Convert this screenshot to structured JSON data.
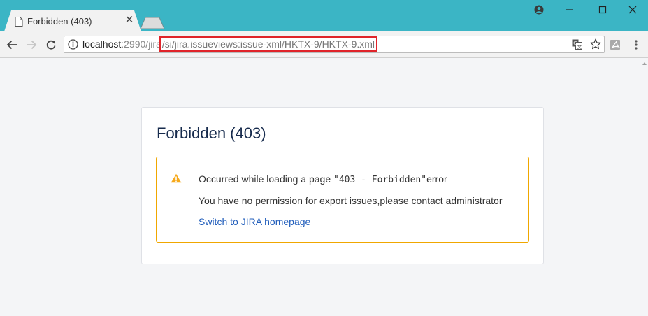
{
  "browser": {
    "tab": {
      "title": "Forbidden (403)",
      "close_glyph": "✕",
      "icon": "document-icon"
    },
    "window_controls": {
      "profile_icon": "account-icon",
      "minimize_icon": "minimize-icon",
      "maximize_icon": "maximize-icon",
      "close_icon": "close-icon"
    },
    "toolbar": {
      "back_icon": "back-arrow-icon",
      "forward_icon": "forward-arrow-icon",
      "reload_icon": "reload-icon",
      "menu_icon": "kebab-menu-icon",
      "extension_icon": "pdf-extension-icon"
    },
    "address": {
      "host": "localhost",
      "port_path": ":2990/jira",
      "highlighted_path": "/si/jira.issueviews:issue-xml/HKTX-9/HKTX-9.xml",
      "highlight_color": "#e0242a"
    }
  },
  "page": {
    "title": "Forbidden (403)",
    "alert": {
      "line1_prefix": "Occurred while loading a page ",
      "line1_code": "\"403 - Forbidden\"",
      "line1_suffix": "error",
      "line2": "You have no permission for export issues,please contact administrator",
      "link": "Switch to JIRA homepage"
    }
  },
  "colors": {
    "titlebar": "#3bb5c5",
    "page_bg": "#f4f5f7",
    "title_text": "#172b4d",
    "warning": "#f0a700",
    "link": "#205dbb"
  }
}
